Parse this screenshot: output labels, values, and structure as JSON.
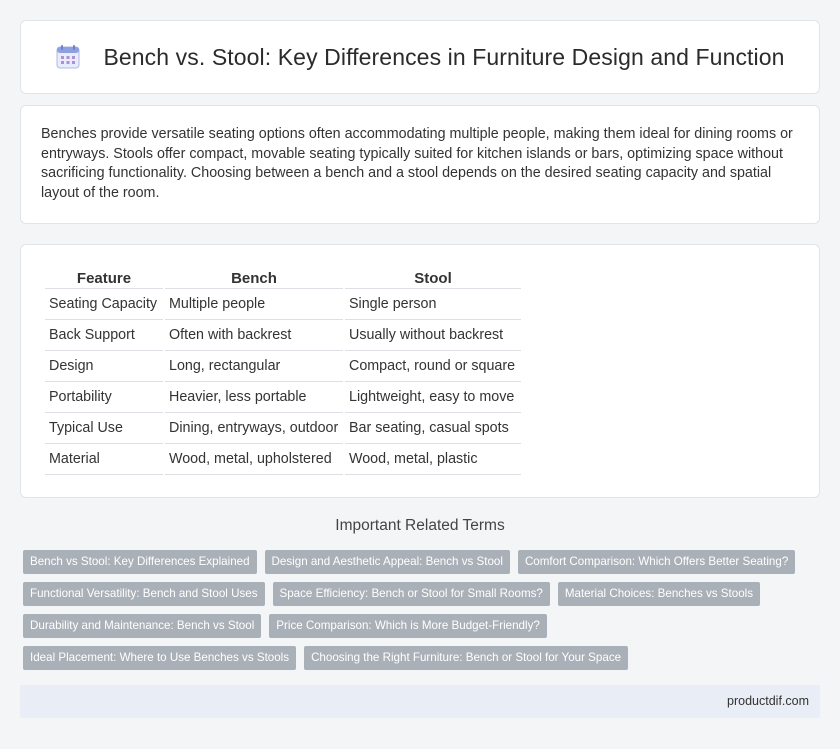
{
  "header": {
    "title": "Bench vs. Stool: Key Differences in Furniture Design and Function",
    "icon": "calendar-icon"
  },
  "intro": {
    "text": "Benches provide versatile seating options often accommodating multiple people, making them ideal for dining rooms or entryways. Stools offer compact, movable seating typically suited for kitchen islands or bars, optimizing space without sacrificing functionality. Choosing between a bench and a stool depends on the desired seating capacity and spatial layout of the room."
  },
  "table": {
    "headers": [
      "Feature",
      "Bench",
      "Stool"
    ],
    "rows": [
      [
        "Seating Capacity",
        "Multiple people",
        "Single person"
      ],
      [
        "Back Support",
        "Often with backrest",
        "Usually without backrest"
      ],
      [
        "Design",
        "Long, rectangular",
        "Compact, round or square"
      ],
      [
        "Portability",
        "Heavier, less portable",
        "Lightweight, easy to move"
      ],
      [
        "Typical Use",
        "Dining, entryways, outdoor",
        "Bar seating, casual spots"
      ],
      [
        "Material",
        "Wood, metal, upholstered",
        "Wood, metal, plastic"
      ]
    ]
  },
  "related": {
    "title": "Important Related Terms",
    "rows": [
      [
        "Bench vs Stool: Key Differences Explained",
        "Design and Aesthetic Appeal: Bench vs Stool",
        "Comfort Comparison: Which Offers Better Seating?"
      ],
      [
        "Functional Versatility: Bench and Stool Uses",
        "Space Efficiency: Bench or Stool for Small Rooms?",
        "Material Choices: Benches vs Stools"
      ],
      [
        "Durability and Maintenance: Bench vs Stool",
        "Price Comparison: Which is More Budget-Friendly?"
      ],
      [
        "Ideal Placement: Where to Use Benches vs Stools",
        "Choosing the Right Furniture: Bench or Stool for Your Space"
      ]
    ]
  },
  "footer": {
    "site": "productdif.com"
  },
  "colors": {
    "tag_bg": "#aab0b8",
    "footer_bg": "#e9edf5",
    "icon_accent": "#7b8fd8"
  }
}
